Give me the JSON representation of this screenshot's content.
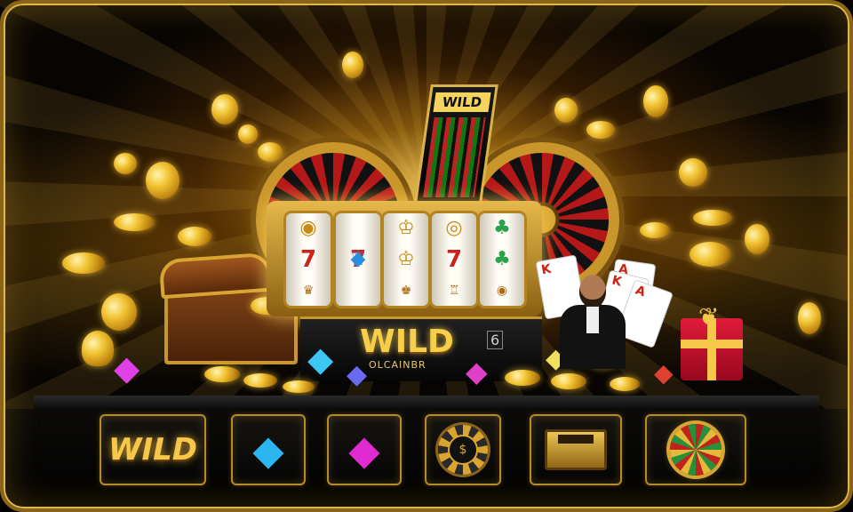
{
  "scene": {
    "tower_label": "WILD",
    "brand": "WILD",
    "brand_sub": "OLCAINBR",
    "brand_badge": "6",
    "reels": [
      [
        "◉",
        "7",
        "♛"
      ],
      [
        "◆",
        "7",
        "♕"
      ],
      [
        "♔",
        "♔",
        "♚"
      ],
      [
        "◎",
        "7",
        "♖"
      ],
      [
        "♣",
        "♣",
        "◉"
      ]
    ],
    "cards": [
      "K",
      "A",
      "K",
      "A"
    ]
  },
  "toolbar": {
    "items": [
      {
        "label": "WILD",
        "icon": "wild-logo-icon"
      },
      {
        "icon": "blue-diamond-icon",
        "color": "#2bb6f0"
      },
      {
        "icon": "pink-diamond-icon",
        "color": "#e02bd0"
      },
      {
        "icon": "casino-chip-icon"
      },
      {
        "icon": "gold-register-icon"
      },
      {
        "icon": "prize-wheel-icon"
      }
    ]
  }
}
